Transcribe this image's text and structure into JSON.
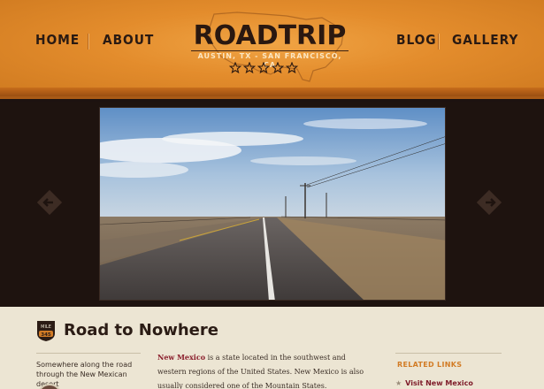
{
  "nav": {
    "left": [
      {
        "label": "HOME"
      },
      {
        "label": "ABOUT"
      }
    ],
    "right": [
      {
        "label": "BLOG"
      },
      {
        "label": "GALLERY"
      }
    ]
  },
  "logo": {
    "title": "ROADTRIP",
    "subtitle": "AUSTIN, TX - SAN FRANCISCO, CA",
    "rating": 5
  },
  "slider": {
    "prev_icon": "arrow-left-icon",
    "next_icon": "arrow-right-icon"
  },
  "post": {
    "badge_top": "MILE",
    "badge_number": "345",
    "title": "Road to Nowhere",
    "caption": "Somewhere along the road through the New Mexican desert",
    "body_highlight": "New Mexico",
    "body_rest": " is a state located in the southwest and western regions of the United States. New Mexico is also usually considered one of the Mountain States."
  },
  "related": {
    "heading": "RELATED LINKS",
    "items": [
      {
        "label": "Visit New Mexico"
      }
    ]
  },
  "colors": {
    "header_orange": "#e38c2c",
    "dark_brown": "#1c1210",
    "cream": "#ece5d3",
    "link_maroon": "#8a1d2b",
    "related_orange": "#d27c26"
  }
}
